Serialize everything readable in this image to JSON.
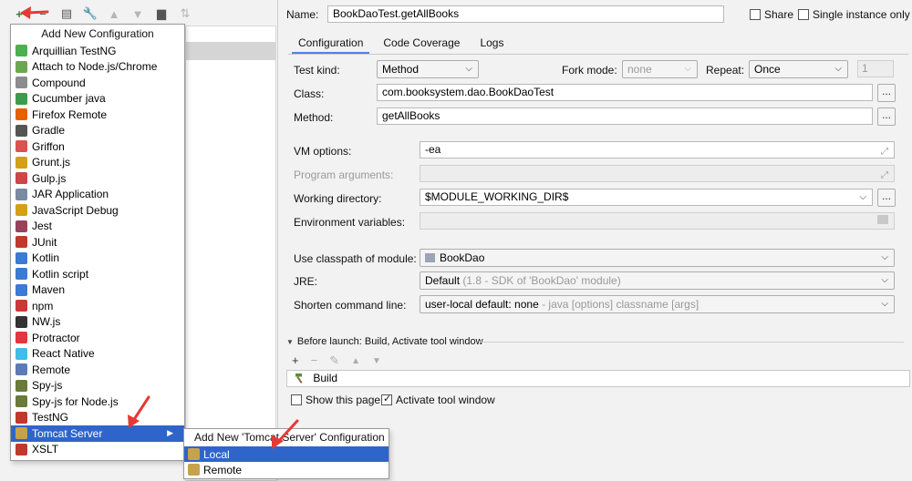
{
  "left_toolbar": {
    "icons": [
      "add-icon",
      "remove-icon",
      "copy-icon",
      "wrench-icon",
      "move-up-icon",
      "move-down-icon",
      "folder-icon",
      "sort-icon"
    ]
  },
  "add_menu": {
    "title": "Add New Configuration",
    "items": [
      {
        "label": "Arquillian TestNG",
        "icon": "arquillian-icon",
        "color": "#4caf50"
      },
      {
        "label": "Attach to Node.js/Chrome",
        "icon": "nodejs-icon",
        "color": "#6aa84f"
      },
      {
        "label": "Compound",
        "icon": "compound-icon",
        "color": "#8c8c8c"
      },
      {
        "label": "Cucumber java",
        "icon": "cucumber-icon",
        "color": "#3c9c4e"
      },
      {
        "label": "Firefox Remote",
        "icon": "firefox-icon",
        "color": "#e66000"
      },
      {
        "label": "Gradle",
        "icon": "gradle-icon",
        "color": "#555555"
      },
      {
        "label": "Griffon",
        "icon": "griffon-icon",
        "color": "#d9534f"
      },
      {
        "label": "Grunt.js",
        "icon": "grunt-icon",
        "color": "#d4a017"
      },
      {
        "label": "Gulp.js",
        "icon": "gulp-icon",
        "color": "#cf4647"
      },
      {
        "label": "JAR Application",
        "icon": "jar-icon",
        "color": "#7a8aa0"
      },
      {
        "label": "JavaScript Debug",
        "icon": "javascript-debug-icon",
        "color": "#d4a017"
      },
      {
        "label": "Jest",
        "icon": "jest-icon",
        "color": "#99425b"
      },
      {
        "label": "JUnit",
        "icon": "junit-icon",
        "color": "#c0392b"
      },
      {
        "label": "Kotlin",
        "icon": "kotlin-icon",
        "color": "#3a7bd5"
      },
      {
        "label": "Kotlin script",
        "icon": "kotlin-script-icon",
        "color": "#3a7bd5"
      },
      {
        "label": "Maven",
        "icon": "maven-icon",
        "color": "#3a7bd5"
      },
      {
        "label": "npm",
        "icon": "npm-icon",
        "color": "#cb3837"
      },
      {
        "label": "NW.js",
        "icon": "nwjs-icon",
        "color": "#333333"
      },
      {
        "label": "Protractor",
        "icon": "protractor-icon",
        "color": "#e0383e"
      },
      {
        "label": "React Native",
        "icon": "react-native-icon",
        "color": "#3dbde8"
      },
      {
        "label": "Remote",
        "icon": "remote-icon",
        "color": "#5a7bb5"
      },
      {
        "label": "Spy-js",
        "icon": "spyjs-icon",
        "color": "#6a7a3a"
      },
      {
        "label": "Spy-js for Node.js",
        "icon": "spyjs-node-icon",
        "color": "#6a7a3a"
      },
      {
        "label": "TestNG",
        "icon": "testng-icon",
        "color": "#c0392b"
      },
      {
        "label": "Tomcat Server",
        "icon": "tomcat-icon",
        "color": "#c8a24a",
        "selected": true,
        "has_submenu": true
      },
      {
        "label": "XSLT",
        "icon": "xslt-icon",
        "color": "#c0392b"
      }
    ]
  },
  "sub_menu": {
    "title": "Add New 'Tomcat Server' Configuration",
    "items": [
      {
        "label": "Local",
        "selected": true
      },
      {
        "label": "Remote",
        "selected": false
      }
    ]
  },
  "header": {
    "name_label": "Name:",
    "name_value": "BookDaoTest.getAllBooks",
    "share_label": "Share",
    "single_instance_label": "Single instance only"
  },
  "tabs": [
    "Configuration",
    "Code Coverage",
    "Logs"
  ],
  "form": {
    "test_kind_label": "Test kind:",
    "test_kind_value": "Method",
    "fork_mode_label": "Fork mode:",
    "fork_mode_value": "none",
    "repeat_label": "Repeat:",
    "repeat_value": "Once",
    "repeat_count": "1",
    "class_label": "Class:",
    "class_value": "com.booksystem.dao.BookDaoTest",
    "method_label": "Method:",
    "method_value": "getAllBooks",
    "vm_options_label": "VM options:",
    "vm_options_value": "-ea",
    "program_args_label": "Program arguments:",
    "working_dir_label": "Working directory:",
    "working_dir_value": "$MODULE_WORKING_DIR$",
    "env_vars_label": "Environment variables:",
    "classpath_label": "Use classpath of module:",
    "classpath_value": "BookDao",
    "jre_label": "JRE:",
    "jre_value": "Default",
    "jre_hint": "(1.8 - SDK of 'BookDao' module)",
    "shorten_label": "Shorten command line:",
    "shorten_value": "user-local default: none",
    "shorten_hint": " - java [options] classname [args]",
    "browse": "..."
  },
  "before_launch": {
    "title": "Before launch: Build, Activate tool window",
    "task": "Build",
    "show_page_label": "Show this page",
    "activate_label": "Activate tool window"
  }
}
